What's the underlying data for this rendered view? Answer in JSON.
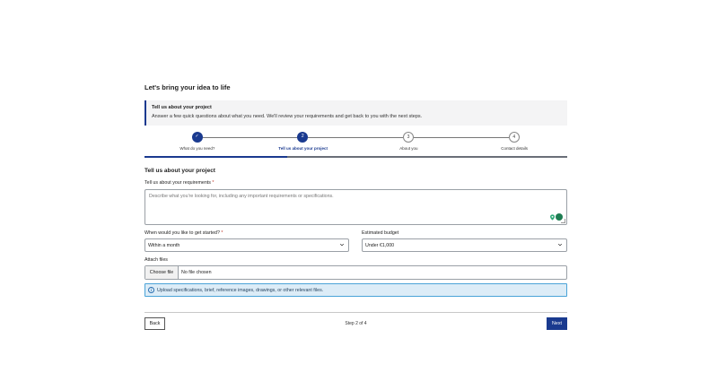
{
  "page": {
    "title": "Let's bring your idea to life"
  },
  "intro": {
    "title": "Tell us about your project",
    "text": "Answer a few quick questions about what you need. We'll review your requirements and get back to you with the next steps."
  },
  "stepper": {
    "steps": [
      {
        "label": "What do you need?",
        "marker": "✓",
        "state": "done"
      },
      {
        "label": "Tell us about your project",
        "marker": "2",
        "state": "current"
      },
      {
        "label": "About you",
        "marker": "3",
        "state": "todo"
      },
      {
        "label": "Contact details",
        "marker": "4",
        "state": "todo"
      }
    ],
    "progress_fraction": 0.3375
  },
  "section": {
    "title": "Tell us about your project"
  },
  "requirements": {
    "label": "Tell us about your requirements",
    "required_mark": "*",
    "placeholder": "Describe what you're looking for, including any important requirements or specifications."
  },
  "start": {
    "label": "When would you like to get started?",
    "required_mark": "*",
    "value": "Within a month"
  },
  "budget": {
    "label": "Estimated budget",
    "value": "Under €1,000"
  },
  "attach": {
    "label": "Attach files",
    "button": "Choose file",
    "status": "No file chosen"
  },
  "info": {
    "text": "Upload specifications, brief, reference images, drawings, or other relevant files."
  },
  "footer": {
    "back": "Back",
    "step_count": "Step 2 of 4",
    "next": "Next"
  },
  "colors": {
    "accent": "#1a3a8f",
    "info_bg": "#dcecf7",
    "info_border": "#4aa3d8"
  }
}
